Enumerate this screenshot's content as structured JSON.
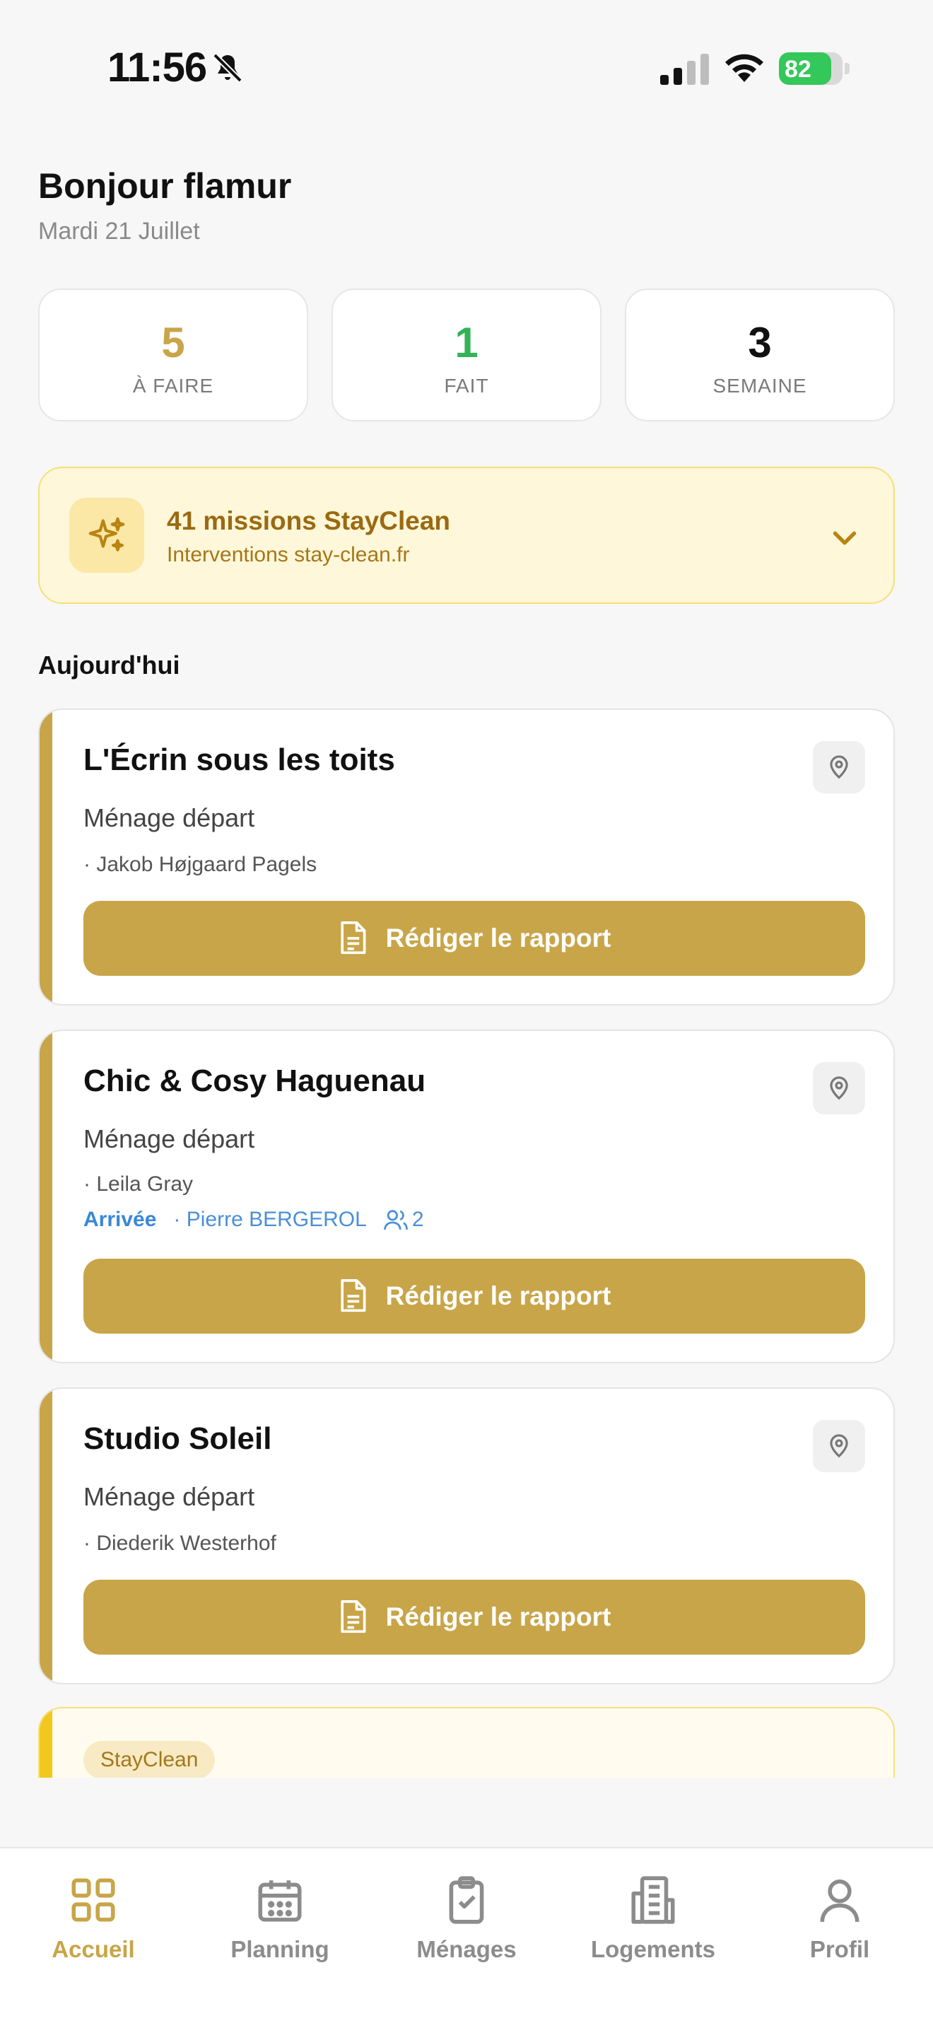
{
  "status_bar": {
    "time": "11:56",
    "battery": "82",
    "battery_level": 0.82
  },
  "header": {
    "greeting": "Bonjour flamur",
    "date": "Mardi 21 Juillet"
  },
  "stats": [
    {
      "value": "5",
      "label": "À FAIRE",
      "color": "#c8a548"
    },
    {
      "value": "1",
      "label": "FAIT",
      "color": "#34b356"
    },
    {
      "value": "3",
      "label": "SEMAINE",
      "color": "#111111"
    }
  ],
  "promo": {
    "title": "41 missions StayClean",
    "subtitle": "Interventions stay-clean.fr"
  },
  "section_title": "Aujourd'hui",
  "cards": [
    {
      "title": "L'Écrin sous les toits",
      "type": "Ménage départ",
      "person": "· Jakob Højgaard Pagels",
      "button": "Rédiger le rapport"
    },
    {
      "title": "Chic & Cosy Haguenau",
      "type": "Ménage départ",
      "person": "· Leila Gray",
      "arrival_label": "Arrivée",
      "arrival_person": "· Pierre BERGEROL",
      "guests": "2",
      "button": "Rédiger le rapport"
    },
    {
      "title": "Studio Soleil",
      "type": "Ménage départ",
      "person": "· Diederik Westerhof",
      "button": "Rédiger le rapport"
    }
  ],
  "partial_card": {
    "badge": "StayClean"
  },
  "tabs": [
    {
      "label": "Accueil",
      "icon": "grid-icon",
      "active": true
    },
    {
      "label": "Planning",
      "icon": "calendar-icon",
      "active": false
    },
    {
      "label": "Ménages",
      "icon": "clipboard-check-icon",
      "active": false
    },
    {
      "label": "Logements",
      "icon": "building-icon",
      "active": false
    },
    {
      "label": "Profil",
      "icon": "user-icon",
      "active": false
    }
  ],
  "colors": {
    "accent": "#c8a548",
    "done": "#34b356",
    "link": "#3b87d6"
  }
}
